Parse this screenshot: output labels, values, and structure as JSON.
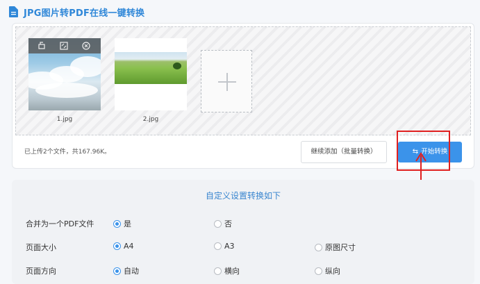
{
  "header": {
    "title": "JPG图片转PDF在线一键转换",
    "icon": "document-icon"
  },
  "upload": {
    "files": [
      {
        "name": "1.jpg",
        "tools": [
          "rotate-icon",
          "fullscreen-icon",
          "close-icon"
        ]
      },
      {
        "name": "2.jpg"
      }
    ],
    "add_icon": "plus-icon",
    "status": "已上传2个文件，共167.96K。",
    "continue_label": "继续添加（批量转换）",
    "start_label": "开始转换"
  },
  "settings": {
    "title": "自定义设置转换如下",
    "rows": [
      {
        "label": "合并为一个PDF文件",
        "options": [
          {
            "label": "是",
            "selected": true
          },
          {
            "label": "否",
            "selected": false
          }
        ]
      },
      {
        "label": "页面大小",
        "options": [
          {
            "label": "A4",
            "selected": true
          },
          {
            "label": "A3",
            "selected": false
          },
          {
            "label": "原图尺寸",
            "selected": false
          }
        ]
      },
      {
        "label": "页面方向",
        "options": [
          {
            "label": "自动",
            "selected": true
          },
          {
            "label": "横向",
            "selected": false
          },
          {
            "label": "纵向",
            "selected": false
          }
        ]
      }
    ]
  },
  "colors": {
    "accent": "#3b93ea",
    "title": "#2f87d8",
    "highlight": "#e01f1f"
  }
}
